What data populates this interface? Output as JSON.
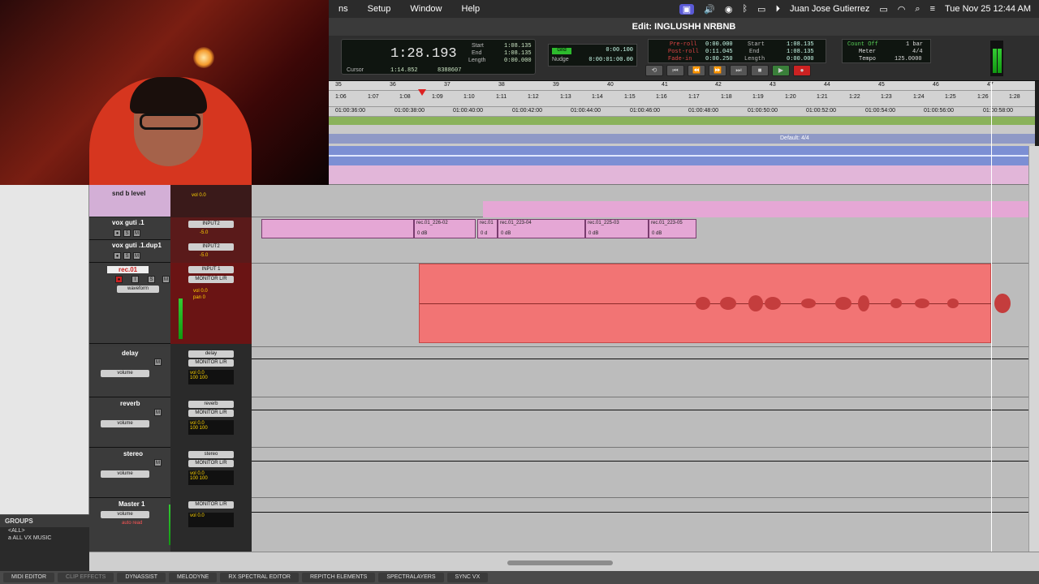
{
  "menubar": {
    "items": [
      "ns",
      "Setup",
      "Window",
      "Help"
    ],
    "user": "Juan Jose Gutierrez",
    "datetime": "Tue Nov 25  12:44 AM"
  },
  "window": {
    "title": "Edit: INGLUSHH NRBNB"
  },
  "counter": {
    "main": "1:28.193",
    "cursor_label": "Cursor",
    "cursor_val": "1:14.852",
    "samples": "8388607",
    "start_label": "Start",
    "end_label": "End",
    "length_label": "Length",
    "start": "1:08.135",
    "end": "1:08.135",
    "length": "0:00.000"
  },
  "grid": {
    "grid_label": "Grid",
    "nudge_label": "Nudge",
    "grid_val": "0:00.100",
    "nudge_val": "0:00:01:00.00"
  },
  "preroll": {
    "preroll_label": "Pre-roll",
    "postroll_label": "Post-roll",
    "fadein_label": "Fade-in",
    "preroll_val": "0:00.000",
    "postroll_val": "0:11.045",
    "fadein_val": "0:00.250",
    "start_label": "Start",
    "end_label": "End",
    "length_label": "Length",
    "start": "1:08.135",
    "end": "1:08.135",
    "length": "0:00.000"
  },
  "countoff": {
    "label": "Count Off",
    "meter_label": "Meter",
    "tempo_label": "Tempo",
    "bars": "1 bar",
    "meter": "4/4",
    "tempo": "125.0000"
  },
  "rulers": {
    "bars": [
      "35",
      "36",
      "37",
      "38",
      "39",
      "40",
      "41",
      "42",
      "43",
      "44",
      "45",
      "46",
      "47"
    ],
    "mins": [
      "1:06",
      "1:07",
      "1:08",
      "1:09",
      "1:10",
      "1:11",
      "1:12",
      "1:13",
      "1:14",
      "1:15",
      "1:16",
      "1:17",
      "1:18",
      "1:19",
      "1:20",
      "1:21",
      "1:22",
      "1:23",
      "1:24",
      "1:25",
      "1:26",
      "1:28"
    ],
    "timecode": [
      "01:00:36:00",
      "01:00:38:00",
      "01:00:40:00",
      "01:00:42:00",
      "01:00:44:00",
      "01:00:46:00",
      "01:00:48:00",
      "01:00:50:00",
      "01:00:52:00",
      "01:00:54:00",
      "01:00:56:00",
      "01:00:58:00"
    ],
    "meter_marker": "Default: 4/4"
  },
  "tracks": [
    {
      "name": "snd b level",
      "io_in": "",
      "vol": "vol 0.0"
    },
    {
      "name": "vox guti .1",
      "io_in": "INPUT2",
      "vol": "-5.0"
    },
    {
      "name": "vox guti .1.dup1",
      "io_in": "INPUT2",
      "vol": "-5.0"
    },
    {
      "name": "rec.01",
      "io_in": "INPUT 1",
      "out": "MONITOR L/R",
      "view": "waveform",
      "vol": "vol 0.0",
      "pan": "pan 0"
    },
    {
      "name": "delay",
      "io_in": "delay",
      "out": "MONITOR L/R",
      "view": "volume",
      "vol": "vol 0.0",
      "pan": "100 100"
    },
    {
      "name": "reverb",
      "io_in": "reverb",
      "out": "MONITOR L/R",
      "view": "volume",
      "vol": "vol 0.0",
      "pan": "100 100"
    },
    {
      "name": "stereo",
      "io_in": "stereo",
      "out": "MONITOR L/R",
      "view": "volume",
      "vol": "vol 0.0",
      "pan": "100 100"
    },
    {
      "name": "Master 1",
      "out": "MONITOR L/R",
      "view": "volume",
      "vol": "vol 0.0",
      "auto": "auto read"
    }
  ],
  "clips": [
    {
      "name": "rec.01_226-02",
      "db": "0 dB"
    },
    {
      "name": "rec.01",
      "db": "0 d"
    },
    {
      "name": "rec.01_223-04",
      "db": "0 dB"
    },
    {
      "name": "rec.01_225-03",
      "db": "0 dB"
    },
    {
      "name": "rec.01_223-05",
      "db": "0 dB"
    }
  ],
  "groups": {
    "header": "GROUPS",
    "items": [
      "<ALL>",
      "a  ALL VX MUSIC"
    ]
  },
  "taskbar": [
    "MIDI EDITOR",
    "CLIP EFFECTS",
    "DYNASSIST",
    "MELODYNE",
    "RX SPECTRAL EDITOR",
    "REPITCH ELEMENTS",
    "SPECTRALAYERS",
    "SYNC VX"
  ]
}
